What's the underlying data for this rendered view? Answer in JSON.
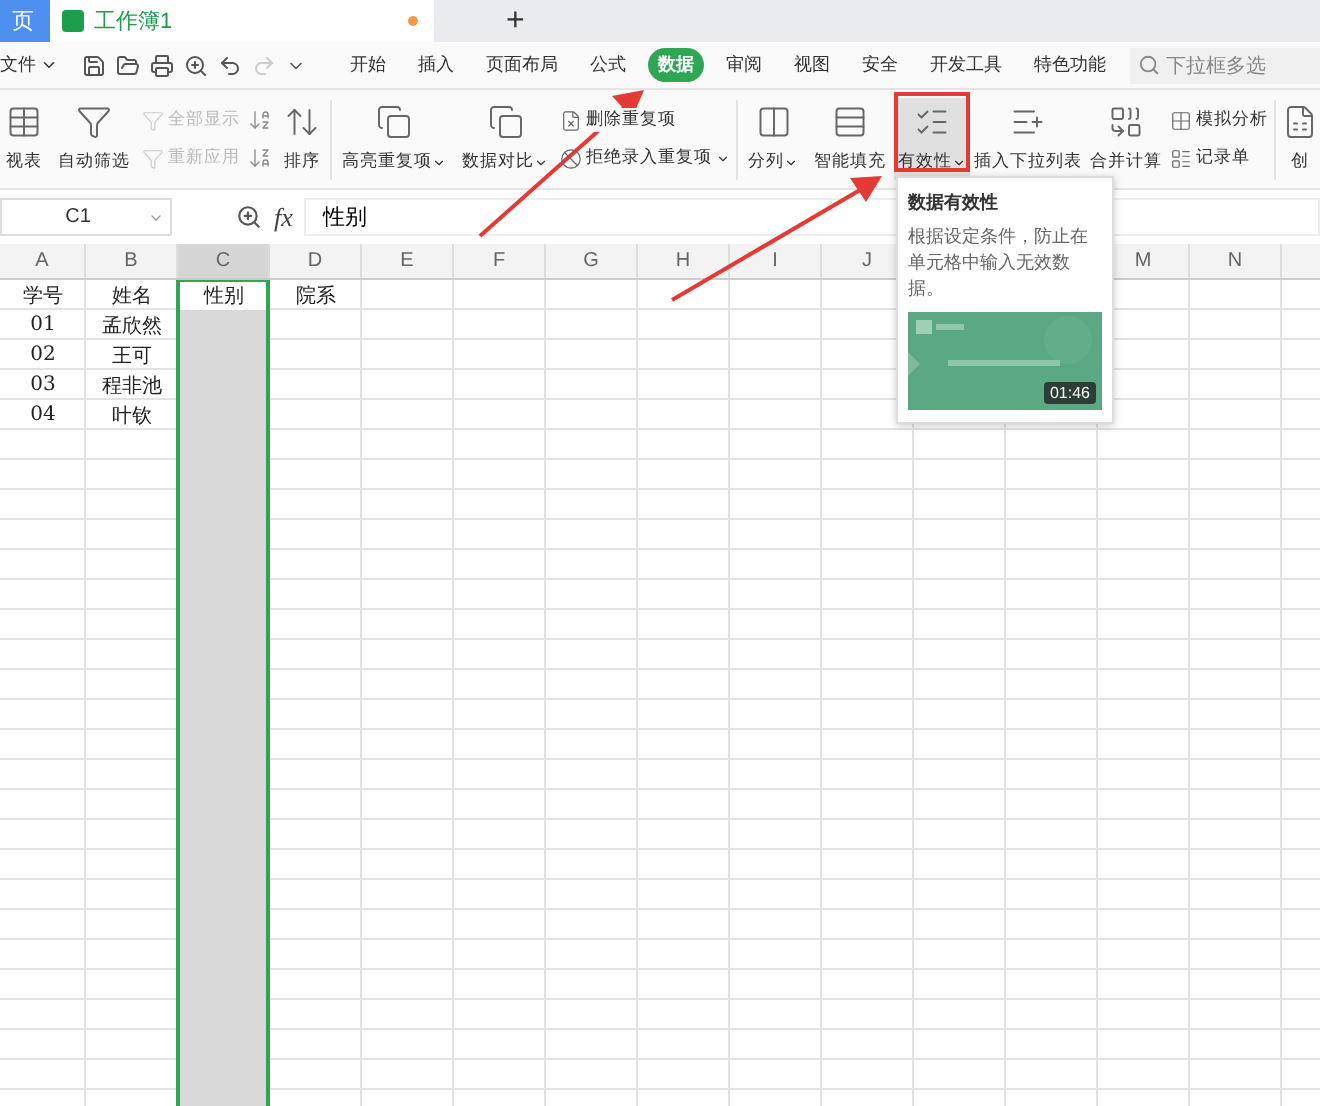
{
  "tabs": [
    {
      "label": "页",
      "selected": false,
      "kind": "home"
    },
    {
      "label": "工作簿1",
      "selected": true,
      "kind": "sheet",
      "modified": true
    }
  ],
  "new_tab": "+",
  "menu": {
    "file": "文件",
    "tabs": [
      {
        "label": "开始",
        "selected": false
      },
      {
        "label": "插入",
        "selected": false
      },
      {
        "label": "页面布局",
        "selected": false
      },
      {
        "label": "公式",
        "selected": false
      },
      {
        "label": "数据",
        "selected": true
      },
      {
        "label": "审阅",
        "selected": false
      },
      {
        "label": "视图",
        "selected": false
      },
      {
        "label": "安全",
        "selected": false
      },
      {
        "label": "开发工具",
        "selected": false
      },
      {
        "label": "特色功能",
        "selected": false
      }
    ],
    "search": {
      "placeholder": "下拉框多选"
    }
  },
  "ribbon": [
    {
      "kind": "big",
      "label": "视表",
      "dropdown": false,
      "highlighted": false
    },
    {
      "kind": "big",
      "label": "自动筛选",
      "dropdown": false,
      "highlighted": false
    },
    {
      "kind": "stack",
      "items": [
        {
          "label": "全部显示",
          "disabled": true
        },
        {
          "label": "重新应用",
          "disabled": true
        }
      ]
    },
    {
      "kind": "sort",
      "label": "排序"
    },
    {
      "kind": "big",
      "label": "高亮重复项",
      "dropdown": true,
      "highlighted": false
    },
    {
      "kind": "big",
      "label": "数据对比",
      "dropdown": true,
      "highlighted": false
    },
    {
      "kind": "stack",
      "items": [
        {
          "label": "删除重复项",
          "disabled": false
        },
        {
          "label": "拒绝录入重复项",
          "dropdown": true,
          "disabled": false
        }
      ]
    },
    {
      "kind": "big",
      "label": "分列",
      "dropdown": true,
      "highlighted": false
    },
    {
      "kind": "big",
      "label": "智能填充",
      "dropdown": false,
      "highlighted": false
    },
    {
      "kind": "big",
      "label": "有效性",
      "dropdown": true,
      "highlighted": true
    },
    {
      "kind": "big",
      "label": "插入下拉列表",
      "dropdown": false,
      "highlighted": false
    },
    {
      "kind": "big",
      "label": "合并计算",
      "dropdown": false,
      "highlighted": false
    },
    {
      "kind": "stack",
      "items": [
        {
          "label": "模拟分析",
          "disabled": false
        },
        {
          "label": "记录单",
          "disabled": false
        }
      ]
    },
    {
      "kind": "big",
      "label": "创",
      "dropdown": false,
      "highlighted": false
    }
  ],
  "formula_bar": {
    "cell": "C1",
    "fx": "fx",
    "value": "性别"
  },
  "sheet": {
    "columns": [
      {
        "label": "A",
        "selected": false
      },
      {
        "label": "B",
        "selected": false
      },
      {
        "label": "C",
        "selected": true
      },
      {
        "label": "D",
        "selected": false
      },
      {
        "label": "E",
        "selected": false
      },
      {
        "label": "F",
        "selected": false
      },
      {
        "label": "G",
        "selected": false
      },
      {
        "label": "H",
        "selected": false
      },
      {
        "label": "I",
        "selected": false
      },
      {
        "label": "J",
        "selected": false
      },
      {
        "label": "M",
        "selected": false
      },
      {
        "label": "N",
        "selected": false
      }
    ],
    "rows": [
      [
        "学号",
        "姓名",
        "性别",
        "院系"
      ],
      [
        "01",
        "孟欣然"
      ],
      [
        "02",
        "王可"
      ],
      [
        "03",
        "程非池"
      ],
      [
        "04",
        "叶钦"
      ]
    ]
  },
  "tooltip": {
    "title": "数据有效性",
    "text": "根据设定条件，防止在单元格中输入无效数据。",
    "video": {
      "kind": "picture",
      "duration": "01:46"
    }
  }
}
